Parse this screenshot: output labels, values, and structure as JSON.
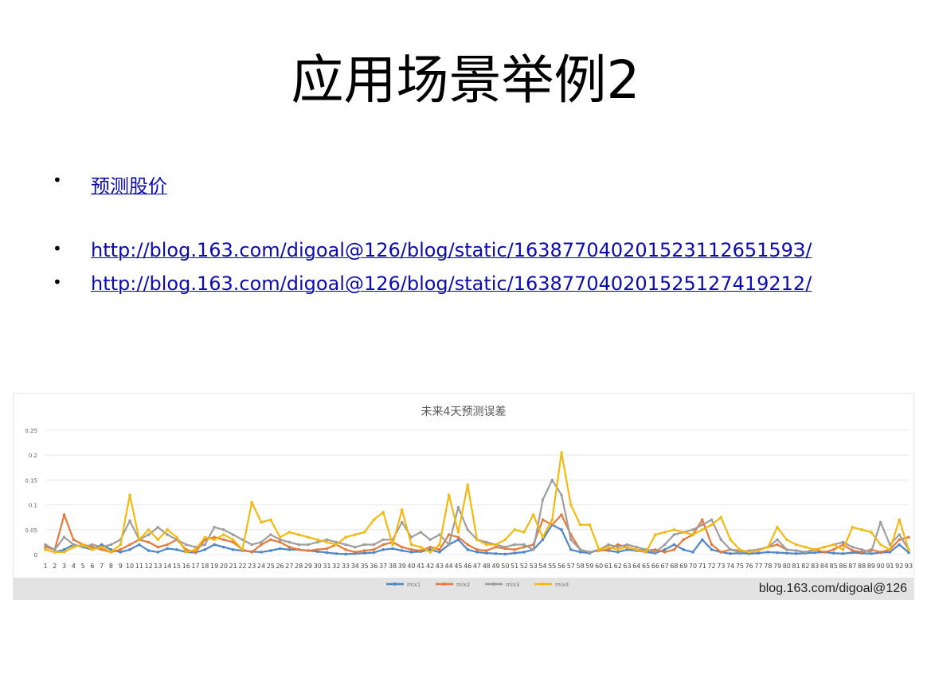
{
  "slide": {
    "title": "应用场景举例2",
    "bullets": [
      {
        "text": "预测股价"
      },
      {
        "text": "http://blog.163.com/digoal@126/blog/static/16387704020152311265159З/"
      },
      {
        "text": "http://blog.163.com/digoal@126/blog/static/163877040201525127419212/"
      }
    ]
  },
  "chart_data": {
    "type": "line",
    "title": "未来4天预测误差",
    "ylim": [
      0,
      0.25
    ],
    "y_ticks": [
      "0",
      "0.05",
      "0.1",
      "0.15",
      "0.2",
      "0.25"
    ],
    "grid": true,
    "legend_position": "bottom",
    "x": [
      1,
      2,
      3,
      4,
      5,
      6,
      7,
      8,
      9,
      10,
      11,
      12,
      13,
      14,
      15,
      16,
      17,
      18,
      19,
      20,
      21,
      22,
      23,
      24,
      25,
      26,
      27,
      28,
      29,
      30,
      31,
      32,
      33,
      34,
      35,
      36,
      37,
      38,
      39,
      40,
      41,
      42,
      43,
      44,
      45,
      46,
      47,
      48,
      49,
      50,
      51,
      52,
      53,
      54,
      55,
      56,
      57,
      58,
      59,
      60,
      61,
      62,
      63,
      64,
      65,
      66,
      67,
      68,
      69,
      70,
      71,
      72,
      73,
      74,
      75,
      76,
      77,
      78,
      79,
      80,
      81,
      82,
      83,
      84,
      85,
      86,
      87,
      88,
      89,
      90,
      91,
      92,
      93
    ],
    "series": [
      {
        "name": "mix1",
        "color": "#4f86c6",
        "values": [
          0.01,
          0.005,
          0.01,
          0.02,
          0.015,
          0.01,
          0.02,
          0.01,
          0.005,
          0.01,
          0.02,
          0.008,
          0.005,
          0.012,
          0.01,
          0.005,
          0.004,
          0.01,
          0.02,
          0.015,
          0.01,
          0.008,
          0.006,
          0.005,
          0.008,
          0.012,
          0.01,
          0.01,
          0.008,
          0.006,
          0.004,
          0.002,
          0.001,
          0.002,
          0.003,
          0.004,
          0.01,
          0.012,
          0.008,
          0.005,
          0.006,
          0.01,
          0.005,
          0.02,
          0.03,
          0.01,
          0.005,
          0.003,
          0.002,
          0.001,
          0.003,
          0.005,
          0.01,
          0.03,
          0.06,
          0.05,
          0.01,
          0.005,
          0.003,
          0.01,
          0.008,
          0.005,
          0.01,
          0.008,
          0.005,
          0.003,
          0.01,
          0.02,
          0.01,
          0.005,
          0.03,
          0.01,
          0.005,
          0.002,
          0.003,
          0.002,
          0.003,
          0.005,
          0.004,
          0.003,
          0.002,
          0.003,
          0.004,
          0.005,
          0.003,
          0.002,
          0.004,
          0.003,
          0.002,
          0.004,
          0.005,
          0.02,
          0.004
        ]
      },
      {
        "name": "mix2",
        "color": "#e57a3a",
        "values": [
          0.015,
          0.01,
          0.08,
          0.03,
          0.02,
          0.015,
          0.01,
          0.005,
          0.01,
          0.02,
          0.03,
          0.025,
          0.015,
          0.02,
          0.03,
          0.01,
          0.005,
          0.03,
          0.035,
          0.03,
          0.025,
          0.01,
          0.005,
          0.02,
          0.03,
          0.025,
          0.015,
          0.01,
          0.008,
          0.01,
          0.012,
          0.02,
          0.01,
          0.005,
          0.008,
          0.01,
          0.02,
          0.025,
          0.015,
          0.01,
          0.008,
          0.015,
          0.01,
          0.04,
          0.035,
          0.02,
          0.01,
          0.008,
          0.015,
          0.012,
          0.01,
          0.015,
          0.02,
          0.07,
          0.06,
          0.08,
          0.04,
          0.01,
          0.005,
          0.008,
          0.01,
          0.02,
          0.015,
          0.01,
          0.008,
          0.01,
          0.005,
          0.01,
          0.03,
          0.04,
          0.07,
          0.02,
          0.005,
          0.01,
          0.008,
          0.005,
          0.01,
          0.015,
          0.02,
          0.01,
          0.008,
          0.005,
          0.01,
          0.005,
          0.01,
          0.02,
          0.008,
          0.005,
          0.01,
          0.005,
          0.01,
          0.03,
          0.035
        ]
      },
      {
        "name": "mix3",
        "color": "#9e9e9e",
        "values": [
          0.02,
          0.01,
          0.035,
          0.02,
          0.015,
          0.02,
          0.015,
          0.02,
          0.03,
          0.068,
          0.03,
          0.04,
          0.055,
          0.04,
          0.03,
          0.02,
          0.015,
          0.02,
          0.055,
          0.05,
          0.04,
          0.03,
          0.02,
          0.025,
          0.04,
          0.03,
          0.025,
          0.02,
          0.02,
          0.025,
          0.03,
          0.025,
          0.02,
          0.015,
          0.02,
          0.02,
          0.03,
          0.03,
          0.065,
          0.035,
          0.045,
          0.03,
          0.04,
          0.02,
          0.095,
          0.05,
          0.03,
          0.025,
          0.02,
          0.015,
          0.02,
          0.02,
          0.01,
          0.11,
          0.15,
          0.12,
          0.03,
          0.01,
          0.005,
          0.01,
          0.02,
          0.015,
          0.02,
          0.015,
          0.01,
          0.005,
          0.02,
          0.04,
          0.045,
          0.05,
          0.06,
          0.07,
          0.03,
          0.01,
          0.005,
          0.008,
          0.01,
          0.015,
          0.03,
          0.01,
          0.008,
          0.005,
          0.01,
          0.015,
          0.02,
          0.025,
          0.015,
          0.01,
          0.005,
          0.065,
          0.02,
          0.04,
          0.01
        ]
      },
      {
        "name": "mix4",
        "color": "#f2b90f",
        "values": [
          0.01,
          0.005,
          0.005,
          0.015,
          0.02,
          0.01,
          0.015,
          0.005,
          0.02,
          0.12,
          0.03,
          0.05,
          0.03,
          0.05,
          0.035,
          0.005,
          0.01,
          0.035,
          0.03,
          0.04,
          0.03,
          0.01,
          0.105,
          0.065,
          0.07,
          0.035,
          0.045,
          0.04,
          0.035,
          0.03,
          0.025,
          0.02,
          0.035,
          0.04,
          0.045,
          0.07,
          0.085,
          0.02,
          0.09,
          0.02,
          0.015,
          0.005,
          0.02,
          0.12,
          0.045,
          0.14,
          0.03,
          0.02,
          0.02,
          0.03,
          0.05,
          0.045,
          0.08,
          0.035,
          0.07,
          0.205,
          0.1,
          0.06,
          0.06,
          0.01,
          0.015,
          0.01,
          0.015,
          0.01,
          0.005,
          0.04,
          0.045,
          0.05,
          0.045,
          0.04,
          0.05,
          0.06,
          0.075,
          0.03,
          0.01,
          0.005,
          0.008,
          0.015,
          0.055,
          0.03,
          0.02,
          0.015,
          0.01,
          0.015,
          0.02,
          0.01,
          0.055,
          0.05,
          0.045,
          0.02,
          0.01,
          0.07,
          0.01
        ]
      }
    ],
    "watermark": "blog.163.com/digoal@126"
  }
}
